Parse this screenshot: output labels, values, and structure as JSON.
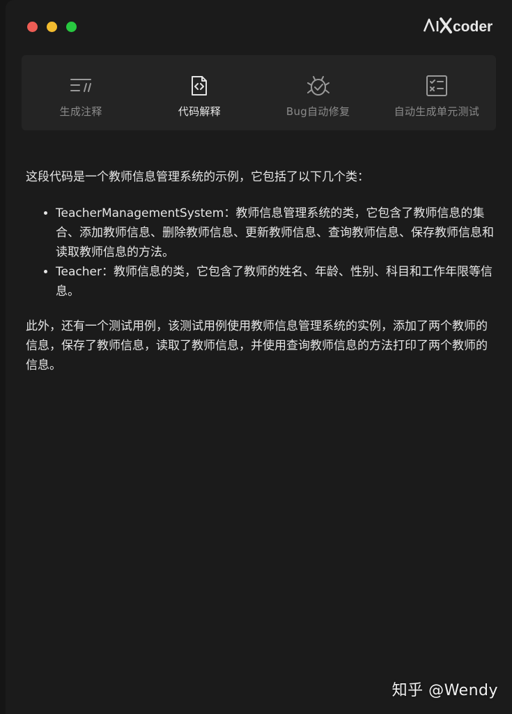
{
  "brand": {
    "name": "aiXcoder"
  },
  "window_controls": {
    "close_color": "#ee5d55",
    "minimize_color": "#f3bc2f",
    "maximize_color": "#28c840"
  },
  "toolbar": {
    "items": [
      {
        "label": "生成注释",
        "icon": "comment-generate-icon",
        "active": false
      },
      {
        "label": "代码解释",
        "icon": "code-file-icon",
        "active": true
      },
      {
        "label": "Bug自动修复",
        "icon": "bug-fix-icon",
        "active": false
      },
      {
        "label": "自动生成单元测试",
        "icon": "unit-test-checklist-icon",
        "active": false
      }
    ]
  },
  "content": {
    "intro": "这段代码是一个教师信息管理系统的示例，它包括了以下几个类：",
    "bullets": [
      "TeacherManagementSystem：教师信息管理系统的类，它包含了教师信息的集合、添加教师信息、删除教师信息、更新教师信息、查询教师信息、保存教师信息和读取教师信息的方法。",
      "Teacher：教师信息的类，它包含了教师的姓名、年龄、性别、科目和工作年限等信息。"
    ],
    "conclusion": "此外，还有一个测试用例，该测试用例使用教师信息管理系统的实例，添加了两个教师的信息，保存了教师信息，读取了教师信息，并使用查询教师信息的方法打印了两个教师的信息。"
  },
  "watermark": "知乎 @Wendy",
  "colors": {
    "window_bg": "#1b1b1b",
    "toolbar_bg": "#242424",
    "text": "#e6e6e6",
    "muted_text": "#8b8b8b"
  }
}
